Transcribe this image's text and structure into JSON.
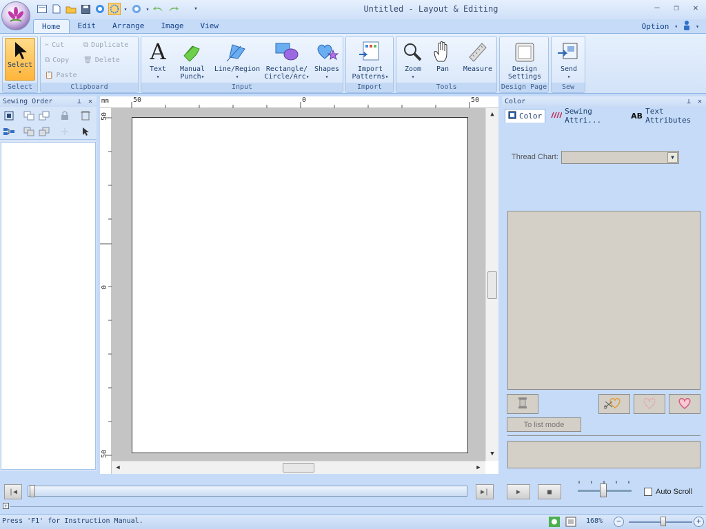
{
  "window": {
    "title": "Untitled - Layout & Editing"
  },
  "ribbon": {
    "tabs": [
      {
        "label": "Home",
        "active": true
      },
      {
        "label": "Edit"
      },
      {
        "label": "Arrange"
      },
      {
        "label": "Image"
      },
      {
        "label": "View"
      }
    ],
    "option_label": "Option",
    "groups": {
      "select": {
        "label": "Select",
        "select_button": "Select"
      },
      "clipboard": {
        "label": "Clipboard",
        "cut": "Cut",
        "duplicate": "Duplicate",
        "copy": "Copy",
        "delete": "Delete",
        "paste": "Paste"
      },
      "input": {
        "label": "Input",
        "text": "Text",
        "manual_punch_1": "Manual",
        "manual_punch_2": "Punch",
        "line_region": "Line/Region",
        "rect_1": "Rectangle/",
        "rect_2": "Circle/Arc",
        "shapes": "Shapes"
      },
      "import": {
        "label": "Import",
        "import_1": "Import",
        "import_2": "Patterns"
      },
      "tools": {
        "label": "Tools",
        "zoom": "Zoom",
        "pan": "Pan",
        "measure": "Measure"
      },
      "design_page": {
        "label": "Design Page",
        "design_1": "Design",
        "design_2": "Settings"
      },
      "sew": {
        "label": "Sew",
        "send": "Send"
      }
    }
  },
  "sewing_order": {
    "title": "Sewing Order"
  },
  "canvas": {
    "ruler_unit": "mm",
    "top_ticks": [
      "50",
      "0",
      "50"
    ],
    "left_ticks": [
      "50",
      "0",
      "50"
    ]
  },
  "color_panel": {
    "title": "Color",
    "tabs": [
      {
        "label": "Color",
        "active": true
      },
      {
        "label": "Sewing Attri..."
      },
      {
        "label": "Text Attributes"
      }
    ],
    "thread_chart_label": "Thread Chart:",
    "thread_chart_value": "",
    "list_mode_button": "To list mode"
  },
  "playback": {
    "auto_scroll_label": "Auto Scroll",
    "auto_scroll_checked": false
  },
  "status": {
    "message": "Press 'F1' for Instruction Manual.",
    "zoom": "168%"
  },
  "colors": {
    "accent": "#ffb53c",
    "ribbon": "#d3e3f8",
    "panel": "#c5dbf7"
  }
}
